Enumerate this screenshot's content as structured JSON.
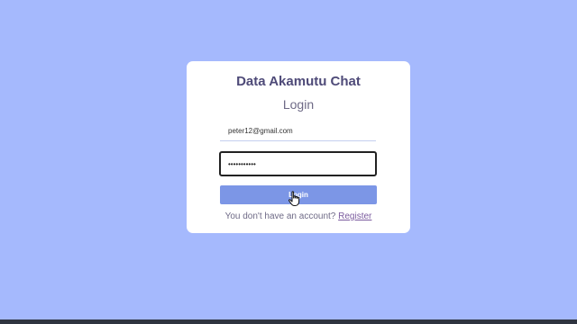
{
  "colors": {
    "background": "#a5b9fd",
    "card": "#ffffff",
    "title": "#4e4a78",
    "button": "#7c96e6",
    "link": "#7a5a9e"
  },
  "app": {
    "title": "Data Akamutu Chat"
  },
  "form": {
    "heading": "Login",
    "email_value": "peter12@gmail.com",
    "password_value": "•••••••••••",
    "login_label": "Login",
    "register_prompt": "You don't have an account?",
    "register_label": "Register"
  },
  "icons": {
    "cursor": "hand-pointer-icon"
  }
}
